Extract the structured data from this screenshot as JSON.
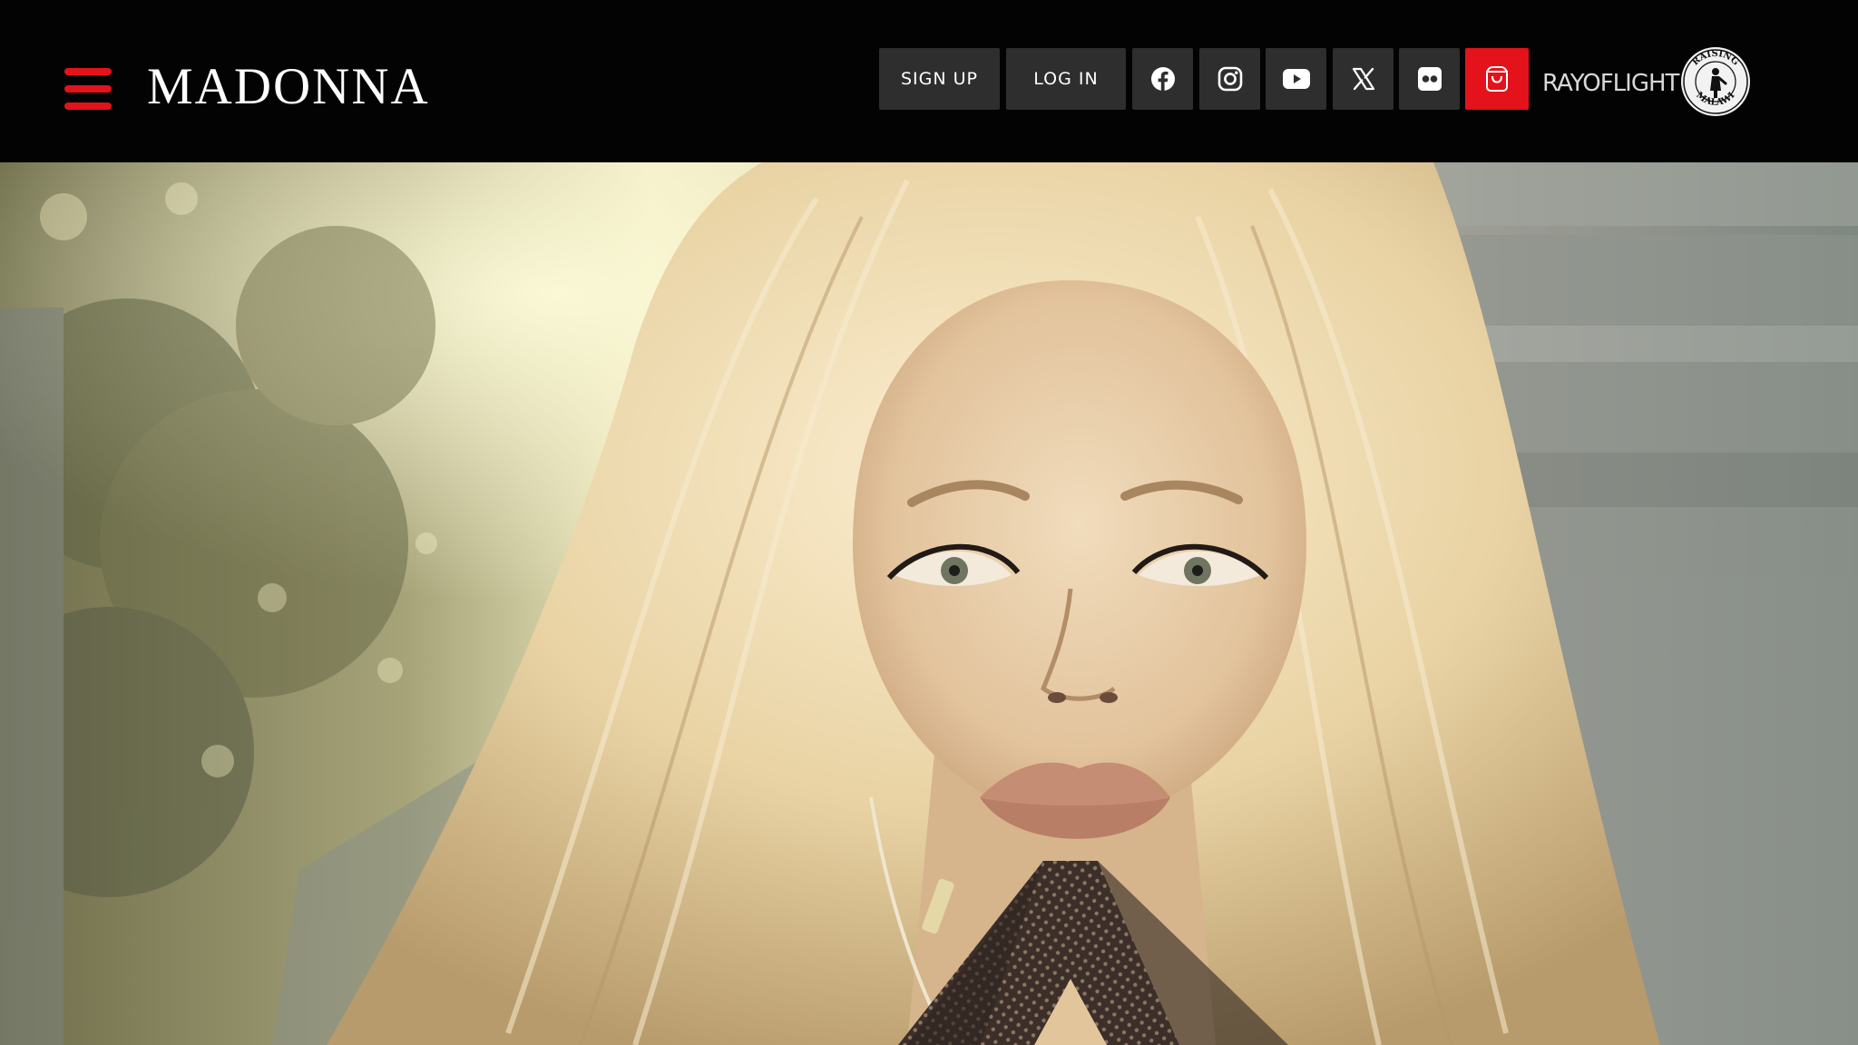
{
  "header": {
    "logo_text": "MADONNA",
    "menu_icon": "hamburger-menu-icon",
    "sign_up_label": "SIGN UP",
    "log_in_label": "LOG IN",
    "social_icons": [
      "facebook-icon",
      "instagram-icon",
      "youtube-icon",
      "x-twitter-icon",
      "flickr-icon"
    ],
    "cart_icon": "shopping-bag-icon",
    "ray_of_light_text": "RAYOFLIGHT",
    "raising_malawi_top_text": "RAISING",
    "raising_malawi_bottom_text": "MALAWI"
  },
  "colors": {
    "accent": "#e3121b",
    "header_bg": "#030303",
    "button_bg": "#2e2e2e"
  },
  "hero": {
    "image": "portrait-photo"
  }
}
